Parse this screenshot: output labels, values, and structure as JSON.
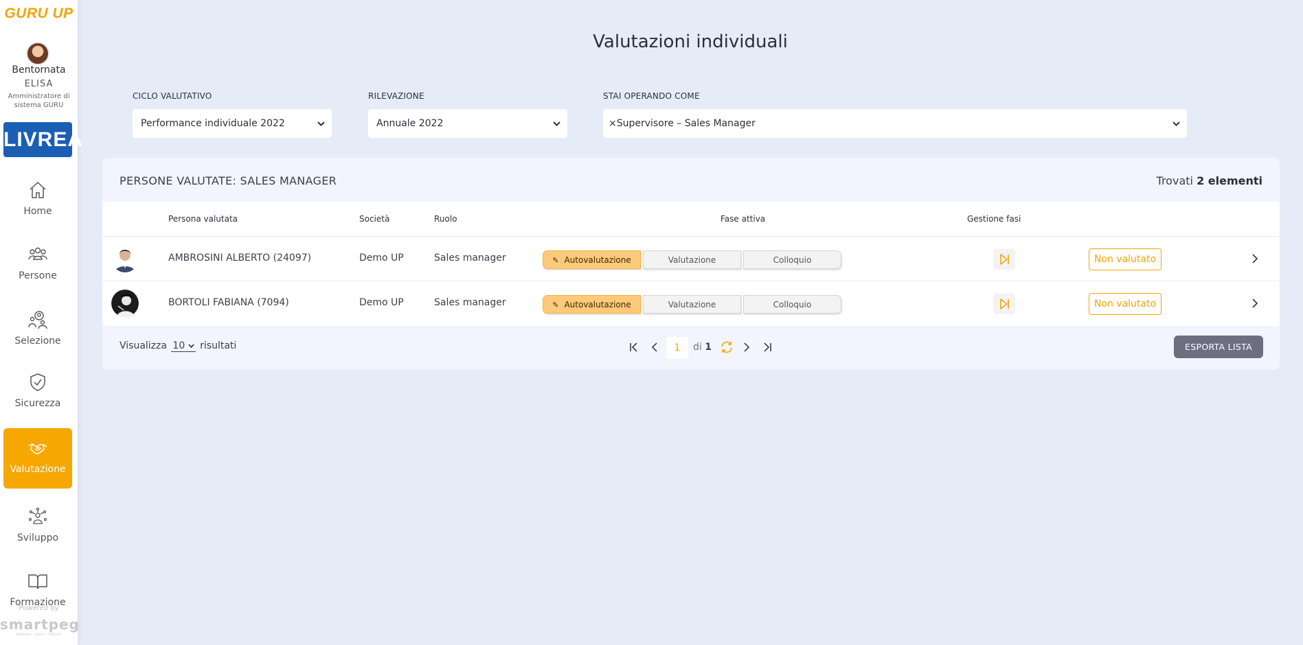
{
  "sidebar": {
    "brand": "GURU UP",
    "greeting": "Bentornata",
    "user_name": "ELISA",
    "user_role": "Amministratore di sistema GURU",
    "client_logo": "LIVREA",
    "nav": [
      {
        "label": "Home",
        "icon": "home-icon"
      },
      {
        "label": "Persone",
        "icon": "people-icon"
      },
      {
        "label": "Selezione",
        "icon": "selection-icon"
      },
      {
        "label": "Sicurezza",
        "icon": "shield-icon"
      },
      {
        "label": "Valutazione",
        "icon": "handshake-icon",
        "active": true
      },
      {
        "label": "Sviluppo",
        "icon": "development-icon"
      },
      {
        "label": "Formazione",
        "icon": "book-icon"
      }
    ],
    "powered_by": "Powered by",
    "powered_brand": "smartpeg",
    "powered_tagline": "Software · talent · network"
  },
  "page": {
    "title": "Valutazioni individuali"
  },
  "filters": {
    "ciclo": {
      "label": "CICLO VALUTATIVO",
      "value": "Performance individuale 2022"
    },
    "rilevazione": {
      "label": "RILEVAZIONE",
      "value": "Annuale 2022"
    },
    "ruolo": {
      "label": "STAI OPERANDO COME",
      "value": "×Supervisore – Sales Manager"
    }
  },
  "list": {
    "title": "PERSONE VALUTATE: SALES MANAGER",
    "found_prefix": "Trovati",
    "found_count": "2 elementi",
    "columns": {
      "person": "Persona valutata",
      "company": "Società",
      "role": "Ruolo",
      "phase": "Fase attiva",
      "manage": "Gestione fasi"
    },
    "rows": [
      {
        "name": "AMBROSINI ALBERTO (24097)",
        "company": "Demo UP",
        "role": "Sales manager",
        "phases": [
          "Autovalutazione",
          "Valutazione",
          "Colloquio"
        ],
        "active_phase": 0,
        "status": "Non valutato"
      },
      {
        "name": "BORTOLI FABIANA (7094)",
        "company": "Demo UP",
        "role": "Sales manager",
        "phases": [
          "Autovalutazione",
          "Valutazione",
          "Colloquio"
        ],
        "active_phase": 0,
        "status": "Non valutato"
      }
    ],
    "footer": {
      "show_label": "Visualizza",
      "page_size": "10",
      "results_label": "risultati",
      "current_page": "1",
      "of_label": "di",
      "total_pages": "1",
      "export_label": "ESPORTA LISTA"
    }
  },
  "colors": {
    "accent": "#f6a700",
    "background": "#e6ebf8",
    "phase_active": "#fdc97a",
    "export_button": "#6d6f80"
  }
}
